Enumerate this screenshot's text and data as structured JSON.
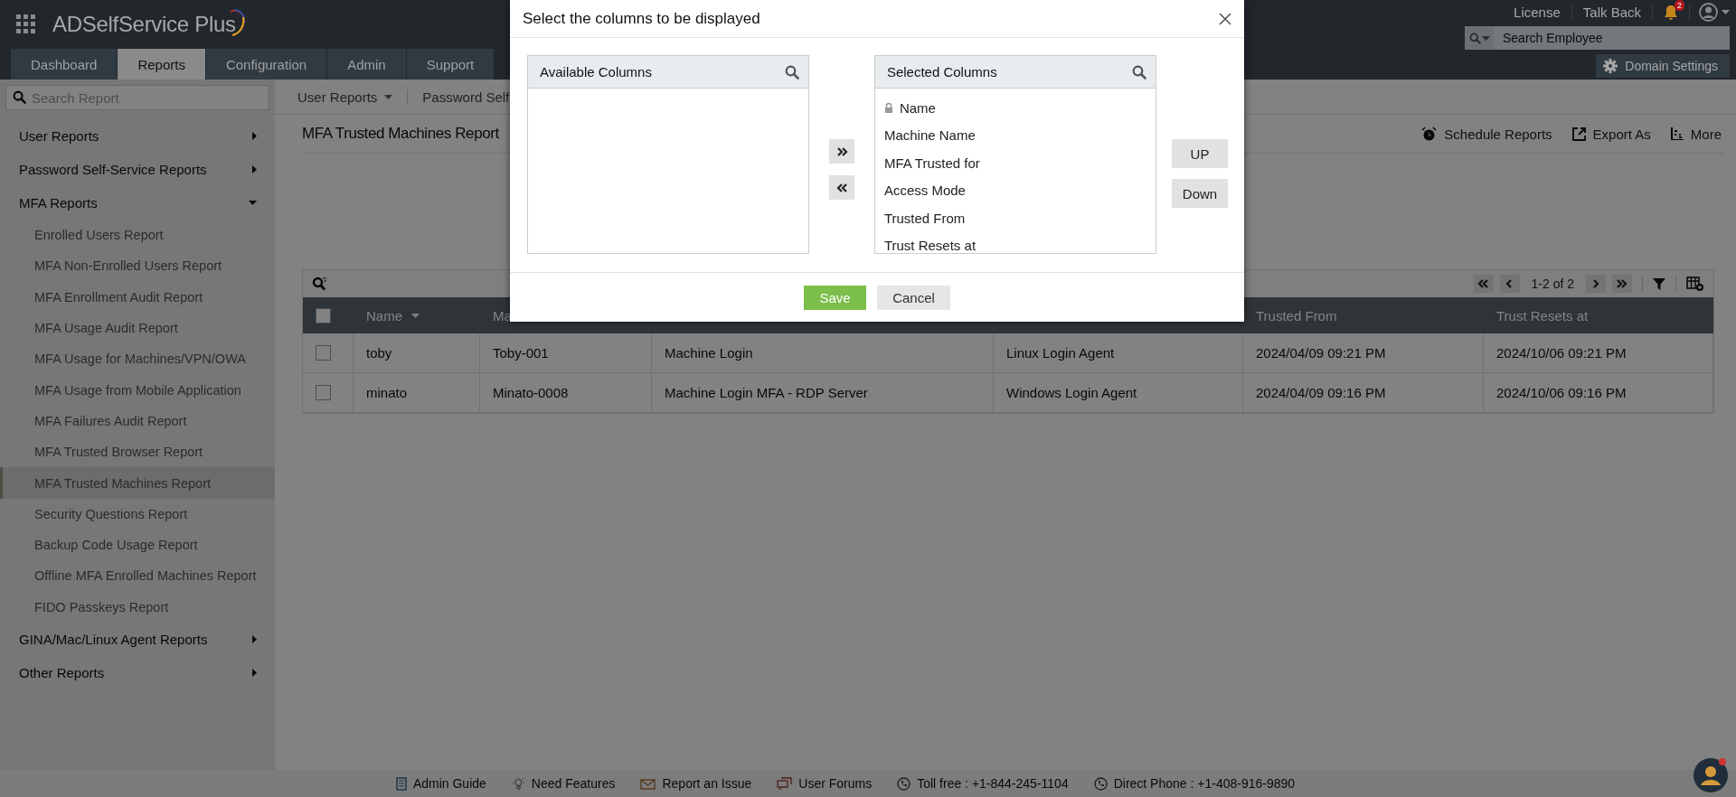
{
  "header": {
    "app_name": "ADSelfService Plus",
    "tabs": [
      {
        "label": "Dashboard",
        "selected": false
      },
      {
        "label": "Reports",
        "selected": true
      },
      {
        "label": "Configuration",
        "selected": false
      },
      {
        "label": "Admin",
        "selected": false
      },
      {
        "label": "Support",
        "selected": false
      }
    ],
    "links": [
      "License",
      "Talk Back"
    ],
    "notification_count": "2",
    "search": {
      "placeholder": "Search Employee"
    },
    "domain_settings": "Domain Settings"
  },
  "sidebar": {
    "search": {
      "placeholder": "Search Report"
    },
    "groups": [
      {
        "label": "User Reports",
        "expanded": false
      },
      {
        "label": "Password Self-Service Reports",
        "expanded": false
      },
      {
        "label": "MFA Reports",
        "expanded": true,
        "children": [
          {
            "label": "Enrolled Users Report",
            "selected": false
          },
          {
            "label": "MFA Non-Enrolled Users Report",
            "selected": false
          },
          {
            "label": "MFA Enrollment Audit Report",
            "selected": false
          },
          {
            "label": "MFA Usage Audit Report",
            "selected": false
          },
          {
            "label": "MFA Usage for Machines/VPN/OWA",
            "selected": false
          },
          {
            "label": "MFA Usage from Mobile Application",
            "selected": false
          },
          {
            "label": "MFA Failures Audit Report",
            "selected": false
          },
          {
            "label": "MFA Trusted Browser Report",
            "selected": false
          },
          {
            "label": "MFA Trusted Machines Report",
            "selected": true
          },
          {
            "label": "Security Questions Report",
            "selected": false
          },
          {
            "label": "Backup Code Usage Report",
            "selected": false
          },
          {
            "label": "Offline MFA Enrolled Machines Report",
            "selected": false
          },
          {
            "label": "FIDO Passkeys Report",
            "selected": false
          }
        ]
      },
      {
        "label": "GINA/Mac/Linux Agent Reports",
        "expanded": false
      },
      {
        "label": "Other Reports",
        "expanded": false
      }
    ]
  },
  "subnav": [
    {
      "label": "User Reports",
      "dropdown": true
    },
    {
      "label": "Password Self",
      "dropdown": false
    }
  ],
  "report": {
    "title": "MFA Trusted Machines Report",
    "actions": [
      {
        "kind": "schedule",
        "label": "Schedule Reports"
      },
      {
        "kind": "export",
        "label": "Export As"
      },
      {
        "kind": "more",
        "label": "More"
      }
    ]
  },
  "table": {
    "pagination": "1-2 of 2",
    "all_selected": false,
    "columns": [
      {
        "label": "Name",
        "sorted": true
      },
      {
        "label": "Ma"
      },
      {},
      {},
      {
        "label": "Trusted From",
        "sorted": false
      },
      {
        "label": "Trust Resets at",
        "sorted": false
      }
    ],
    "rows": [
      {
        "checked": false,
        "cells": [
          "toby",
          "Toby-001",
          "Machine Login",
          "Linux Login Agent",
          "2024/04/09 09:21 PM",
          "2024/10/06 09:21 PM"
        ]
      },
      {
        "checked": false,
        "cells": [
          "minato",
          "Minato-0008",
          "Machine Login MFA - RDP Server",
          "Windows Login Agent",
          "2024/04/09 09:16 PM",
          "2024/10/06 09:16 PM"
        ]
      }
    ]
  },
  "footer": [
    {
      "kind": "guide",
      "label": "Admin Guide"
    },
    {
      "kind": "idea",
      "label": "Need Features"
    },
    {
      "kind": "issue",
      "label": "Report an Issue"
    },
    {
      "kind": "forum",
      "label": "User Forums"
    },
    {
      "kind": "phone",
      "label": "Toll free : +1-844-245-1104"
    },
    {
      "kind": "phone",
      "label": "Direct Phone : +1-408-916-9890"
    }
  ],
  "dialog": {
    "title": "Select the columns to be displayed",
    "available": {
      "title": "Available Columns"
    },
    "selected": {
      "title": "Selected Columns",
      "items": [
        {
          "label": "Name",
          "locked": true
        },
        {
          "label": "Machine Name",
          "locked": false
        },
        {
          "label": "MFA Trusted for",
          "locked": false
        },
        {
          "label": "Access Mode",
          "locked": false
        },
        {
          "label": "Trusted From",
          "locked": false
        },
        {
          "label": "Trust Resets at",
          "locked": false
        }
      ]
    },
    "order_buttons": [
      "UP",
      "Down"
    ],
    "save": "Save",
    "cancel": "Cancel"
  }
}
